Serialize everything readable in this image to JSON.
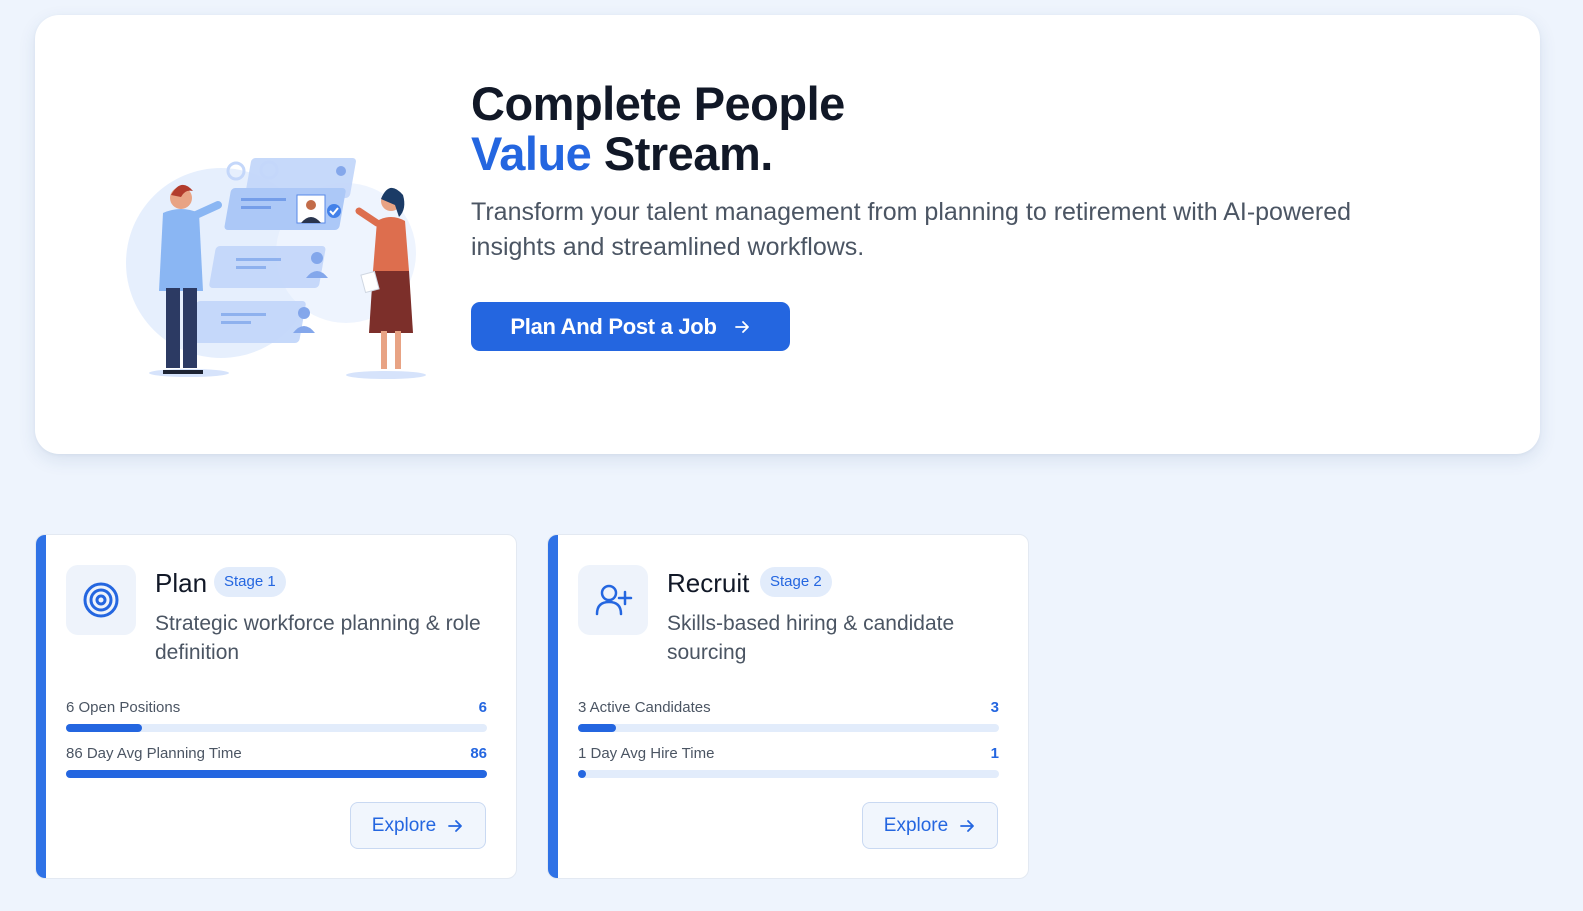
{
  "hero": {
    "title_line1": "Complete People",
    "title_accent": "Value",
    "title_rest": "Stream.",
    "subtitle": "Transform your talent management from planning to retirement with AI-powered insights and streamlined workflows.",
    "cta_label": "Plan And Post a Job",
    "cta_icon": "arrow-right-icon",
    "illustration": "recruitment-illustration"
  },
  "colors": {
    "accent": "#2466e0",
    "page_bg": "#eef4fd",
    "card_bar": "#2f72e6"
  },
  "stages": [
    {
      "name": "Plan",
      "badge": "Stage 1",
      "icon": "target-icon",
      "description": "Strategic workforce planning & role definition",
      "metrics": [
        {
          "label": "6 Open Positions",
          "value": "6",
          "progress": 0.18
        },
        {
          "label": "86 Day Avg Planning Time",
          "value": "86",
          "progress": 1.0
        }
      ],
      "explore_label": "Explore"
    },
    {
      "name": "Recruit",
      "badge": "Stage 2",
      "icon": "user-plus-icon",
      "description": "Skills-based hiring & candidate sourcing",
      "metrics": [
        {
          "label": "3 Active Candidates",
          "value": "3",
          "progress": 0.09
        },
        {
          "label": "1 Day Avg Hire Time",
          "value": "1",
          "progress": 0.02
        }
      ],
      "explore_label": "Explore"
    }
  ]
}
